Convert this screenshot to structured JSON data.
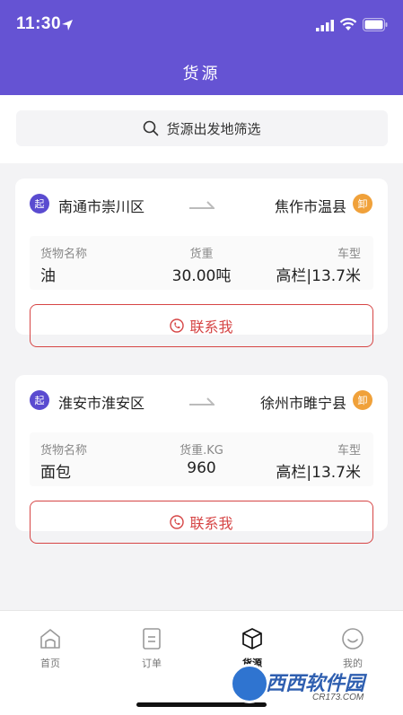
{
  "status_bar": {
    "time": "11:30"
  },
  "header": {
    "title": "货源"
  },
  "search": {
    "label": "货源出发地筛选"
  },
  "cards": [
    {
      "start_badge": "起",
      "origin": "南通市崇川区",
      "destination": "焦作市温县",
      "end_badge": "卸",
      "cargo_label": "货物名称",
      "cargo_value": "油",
      "weight_label": "货重",
      "weight_value": "30.00吨",
      "vehicle_label": "车型",
      "vehicle_value": "高栏|13.7米",
      "contact_label": "联系我"
    },
    {
      "start_badge": "起",
      "origin": "淮安市淮安区",
      "destination": "徐州市睢宁县",
      "end_badge": "卸",
      "cargo_label": "货物名称",
      "cargo_value": "面包",
      "weight_label": "货重.KG",
      "weight_value": "960",
      "vehicle_label": "车型",
      "vehicle_value": "高栏|13.7米",
      "contact_label": "联系我"
    }
  ],
  "tabbar": {
    "items": [
      {
        "label": "首页",
        "icon": "home-icon",
        "active": false
      },
      {
        "label": "订单",
        "icon": "order-icon",
        "active": false
      },
      {
        "label": "货源",
        "icon": "cargo-box-icon",
        "active": true
      },
      {
        "label": "我的",
        "icon": "profile-smile-icon",
        "active": false
      }
    ]
  },
  "watermark": {
    "text": "西西软件园",
    "url": "CR173.COM"
  },
  "colors": {
    "header": "#6553d3",
    "start_badge": "#5a4bd0",
    "end_badge": "#f0a13a",
    "contact": "#d64545"
  }
}
